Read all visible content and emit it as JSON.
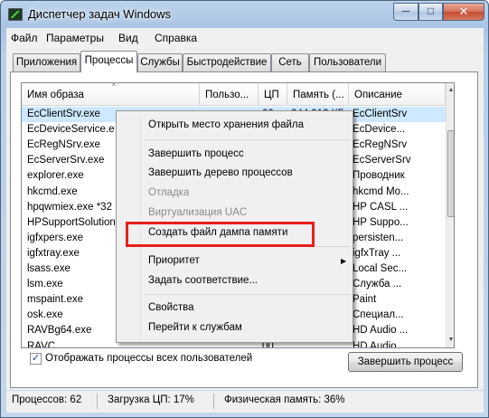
{
  "window": {
    "title": "Диспетчер задач Windows"
  },
  "title_buttons": {
    "minimize": "─",
    "maximize": "□",
    "close": "✕"
  },
  "menu": [
    "Файл",
    "Параметры",
    "Вид",
    "Справка"
  ],
  "tabs": [
    "Приложения",
    "Процессы",
    "Службы",
    "Быстродействие",
    "Сеть",
    "Пользователи"
  ],
  "active_tab": "Процессы",
  "columns": [
    "Имя образа",
    "Пользо...",
    "ЦП",
    "Память (...",
    "Описание"
  ],
  "sort_indicator": "^",
  "processes": [
    {
      "name": "EcClientSrv.exe",
      "cpu": "00",
      "memory": "244 912 КБ",
      "desc": "EcClientSrv",
      "selected": true
    },
    {
      "name": "EcDeviceService.e",
      "cpu": "",
      "memory": "",
      "desc": "EcDevice..."
    },
    {
      "name": "EcRegNSrv.exe",
      "cpu": "",
      "memory": "",
      "desc": "EcRegNSrv"
    },
    {
      "name": "EcServerSrv.exe",
      "cpu": "",
      "memory": "",
      "desc": "EcServerSrv"
    },
    {
      "name": "explorer.exe",
      "cpu": "",
      "memory": "",
      "desc": "Проводник"
    },
    {
      "name": "hkcmd.exe",
      "cpu": "",
      "memory": "",
      "desc": "hkcmd Mo..."
    },
    {
      "name": "hpqwmiex.exe *32",
      "cpu": "",
      "memory": "",
      "desc": "HP CASL ..."
    },
    {
      "name": "HPSupportSolution",
      "cpu": "",
      "memory": "",
      "desc": "HP Suppo..."
    },
    {
      "name": "igfxpers.exe",
      "cpu": "",
      "memory": "",
      "desc": "persisten..."
    },
    {
      "name": "igfxtray.exe",
      "cpu": "",
      "memory": "",
      "desc": "igfxTray ..."
    },
    {
      "name": "lsass.exe",
      "cpu": "",
      "memory": "",
      "desc": "Local Sec..."
    },
    {
      "name": "lsm.exe",
      "cpu": "",
      "memory": "",
      "desc": "Служба ..."
    },
    {
      "name": "mspaint.exe",
      "cpu": "",
      "memory": "",
      "desc": "Paint"
    },
    {
      "name": "osk.exe",
      "cpu": "",
      "memory": "",
      "desc": "Специал..."
    },
    {
      "name": "RAVBg64.exe",
      "cpu": "",
      "memory": "",
      "desc": "HD Audio ..."
    },
    {
      "name": "RAVC...",
      "cpu": "00",
      "memory": "...",
      "desc": "HD Audio ..."
    }
  ],
  "show_all_users": {
    "label": "Отображать процессы всех пользователей",
    "checked": true,
    "mark": "✓"
  },
  "end_process_button": "Завершить процесс",
  "context_menu": {
    "items": [
      {
        "label": "Открыть место хранения файла",
        "disabled": false
      },
      {
        "label": "Завершить процесс",
        "disabled": false
      },
      {
        "label": "Завершить дерево процессов",
        "disabled": false
      },
      {
        "label": "Отладка",
        "disabled": true
      },
      {
        "label": "Виртуализация UAC",
        "disabled": true
      },
      {
        "label": "Создать файл дампа памяти",
        "disabled": false,
        "highlighted": true
      },
      {
        "label": "Приоритет",
        "disabled": false,
        "submenu": true
      },
      {
        "label": "Задать соответствие...",
        "disabled": false
      },
      {
        "label": "Свойства",
        "disabled": false
      },
      {
        "label": "Перейти к службам",
        "disabled": false
      }
    ],
    "submenu_arrow": "▶"
  },
  "status": {
    "processes": "Процессов: 62",
    "cpu": "Загрузка ЦП: 17%",
    "memory": "Физическая память: 36%"
  },
  "colors": {
    "highlight_box": "#e81d1d",
    "selected_row": "#cde8ff"
  }
}
